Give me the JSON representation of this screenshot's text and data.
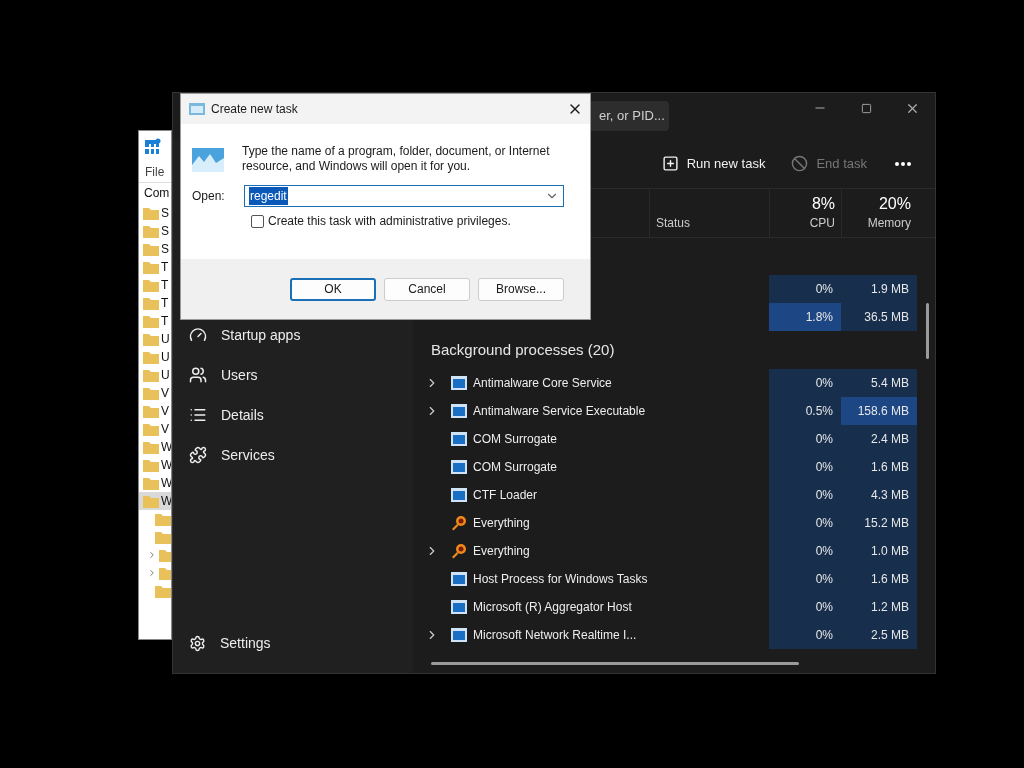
{
  "registry_editor": {
    "menu": "File",
    "address": "Com",
    "tree": [
      {
        "label": "S",
        "selected": false
      },
      {
        "label": "S",
        "selected": false
      },
      {
        "label": "S",
        "selected": false
      },
      {
        "label": "T",
        "selected": false
      },
      {
        "label": "T",
        "selected": false
      },
      {
        "label": "T",
        "selected": false
      },
      {
        "label": "T",
        "selected": false
      },
      {
        "label": "U",
        "selected": false
      },
      {
        "label": "U",
        "selected": false
      },
      {
        "label": "U",
        "selected": false
      },
      {
        "label": "V",
        "selected": false
      },
      {
        "label": "V",
        "selected": false
      },
      {
        "label": "V",
        "selected": false
      },
      {
        "label": "W",
        "selected": false
      },
      {
        "label": "W",
        "selected": false
      },
      {
        "label": "W",
        "selected": false
      },
      {
        "label": "W",
        "selected": true
      }
    ],
    "subtree": [
      {
        "expandable": false
      },
      {
        "expandable": false
      },
      {
        "expandable": true
      },
      {
        "expandable": true
      },
      {
        "expandable": false
      }
    ]
  },
  "task_manager": {
    "search": {
      "placeholder": "er, or PID..."
    },
    "toolbar": [
      {
        "label": "Run new task",
        "kind": "run",
        "disabled": false
      },
      {
        "label": "End task",
        "kind": "end",
        "disabled": true
      }
    ],
    "sidebar": [
      {
        "label": "Startup apps",
        "kind": "startup"
      },
      {
        "label": "Users",
        "kind": "users"
      },
      {
        "label": "Details",
        "kind": "details"
      },
      {
        "label": "Services",
        "kind": "services"
      }
    ],
    "settings": {
      "label": "Settings"
    },
    "columns": {
      "status": "Status",
      "cpu": {
        "percent": "8%",
        "label": "CPU"
      },
      "memory": {
        "percent": "20%",
        "label": "Memory"
      }
    },
    "app_rows": [
      {
        "cpu": "0%",
        "memory": "1.9 MB",
        "cpu_high": false,
        "memory_high": false
      },
      {
        "cpu": "1.8%",
        "memory": "36.5 MB",
        "cpu_high": true,
        "memory_high": false
      }
    ],
    "section": "Background processes (20)",
    "processes": [
      {
        "name": "Antimalware Core Service",
        "kind": "window",
        "expandable": true,
        "cpu": "0%",
        "memory": "5.4 MB",
        "cpu_high": false,
        "memory_high": false
      },
      {
        "name": "Antimalware Service Executable",
        "kind": "window",
        "expandable": true,
        "cpu": "0.5%",
        "memory": "158.6 MB",
        "cpu_high": false,
        "memory_high": true
      },
      {
        "name": "COM Surrogate",
        "kind": "window",
        "expandable": false,
        "cpu": "0%",
        "memory": "2.4 MB",
        "cpu_high": false,
        "memory_high": false
      },
      {
        "name": "COM Surrogate",
        "kind": "window",
        "expandable": false,
        "cpu": "0%",
        "memory": "1.6 MB",
        "cpu_high": false,
        "memory_high": false
      },
      {
        "name": "CTF Loader",
        "kind": "window",
        "expandable": false,
        "cpu": "0%",
        "memory": "4.3 MB",
        "cpu_high": false,
        "memory_high": false
      },
      {
        "name": "Everything",
        "kind": "magnifier",
        "expandable": false,
        "cpu": "0%",
        "memory": "15.2 MB",
        "cpu_high": false,
        "memory_high": false
      },
      {
        "name": "Everything",
        "kind": "magnifier",
        "expandable": true,
        "cpu": "0%",
        "memory": "1.0 MB",
        "cpu_high": false,
        "memory_high": false
      },
      {
        "name": "Host Process for Windows Tasks",
        "kind": "window",
        "expandable": false,
        "cpu": "0%",
        "memory": "1.6 MB",
        "cpu_high": false,
        "memory_high": false
      },
      {
        "name": "Microsoft (R) Aggregator Host",
        "kind": "window",
        "expandable": false,
        "cpu": "0%",
        "memory": "1.2 MB",
        "cpu_high": false,
        "memory_high": false
      },
      {
        "name": "Microsoft Network Realtime I...",
        "kind": "window",
        "expandable": true,
        "cpu": "0%",
        "memory": "2.5 MB",
        "cpu_high": false,
        "memory_high": false
      }
    ]
  },
  "dialog": {
    "title": "Create new task",
    "message": "Type the name of a program, folder, document, or Internet resource, and Windows will open it for you.",
    "open_label": "Open:",
    "value": "regedit",
    "checkbox": {
      "label": "Create this task with administrative privileges.",
      "checked": false
    },
    "buttons": [
      {
        "label": "OK",
        "default": true
      },
      {
        "label": "Cancel",
        "default": false
      },
      {
        "label": "Browse...",
        "default": false
      }
    ]
  }
}
